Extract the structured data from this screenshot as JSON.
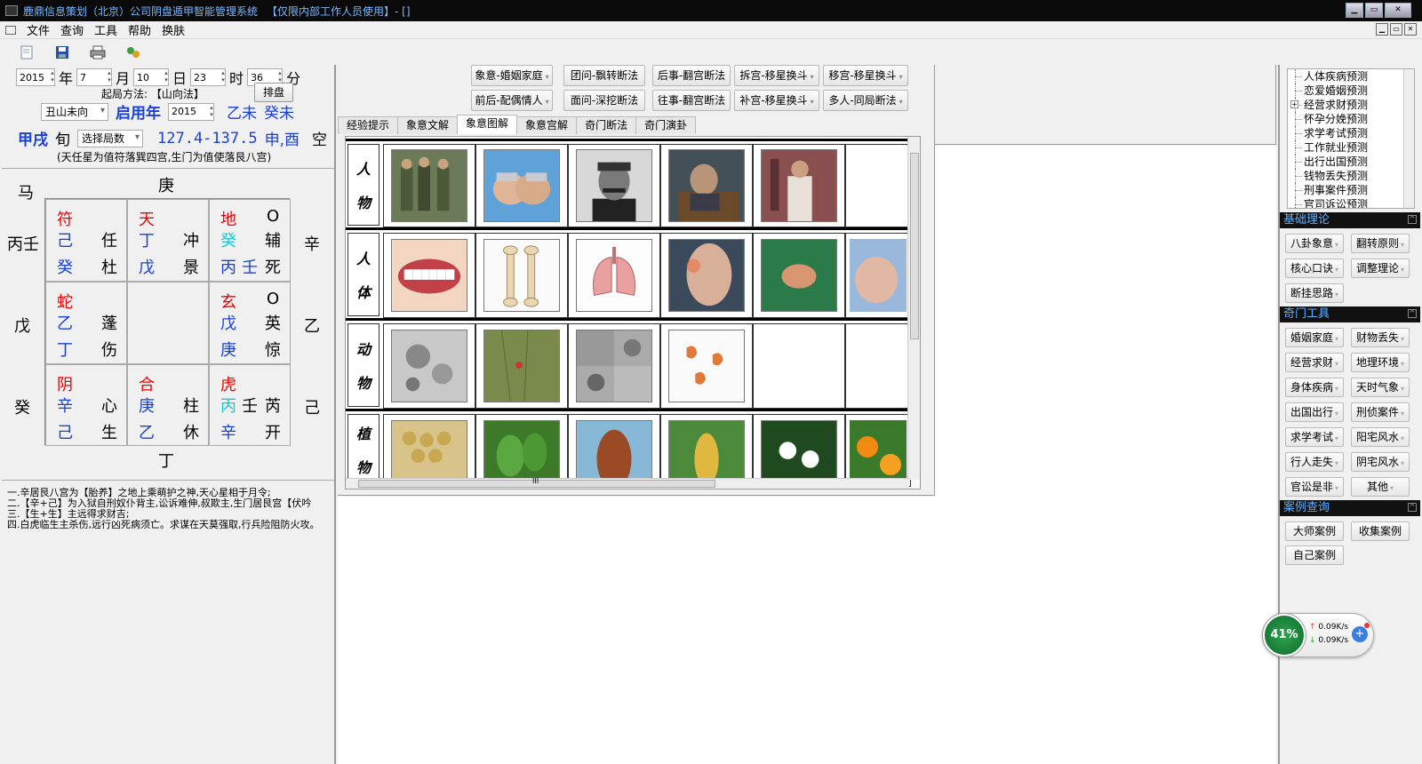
{
  "window": {
    "title": "鹿鼎信息策划（北京）公司阴盘遁甲智能管理系统",
    "title_tag": "【仅限内部工作人员使用】- []"
  },
  "menu": [
    "文件",
    "查询",
    "工具",
    "帮助",
    "换肤"
  ],
  "toolbar": [
    "new-icon",
    "save-icon",
    "print-icon",
    "plugin-icon"
  ],
  "datetime": {
    "year": "2015",
    "year_unit": "年",
    "month": "7",
    "month_unit": "月",
    "day": "10",
    "day_unit": "日",
    "hour": "23",
    "hour_unit": "时",
    "minute": "36",
    "minute_unit": "分"
  },
  "method": {
    "label": "起局方法: 【山向法】",
    "button": "排盘"
  },
  "row3": {
    "direction": "丑山未向",
    "use_year_label": "启用年",
    "use_year": "2015",
    "gz1": "乙未",
    "gz2": "癸未"
  },
  "row4": {
    "xun": "甲戌",
    "xun_unit": "旬",
    "ju_select": "选择局数",
    "degree": "127.4-137.5",
    "stem": "申,酉",
    "kong": "空"
  },
  "row5": {
    "note": "(天任星为值符落巽四宫,生门为值使落艮八宫)"
  },
  "pan": {
    "top_left": "马",
    "top": "庚",
    "bottom": "丁",
    "left": [
      "丙壬",
      "戊",
      "癸"
    ],
    "right": [
      "辛",
      "乙",
      "己"
    ],
    "cells": [
      {
        "god": "符",
        "sky_stem": "己",
        "star": "任",
        "earth_stem": "癸",
        "door": "杜"
      },
      {
        "god": "天",
        "sky_stem": "丁",
        "star": "冲",
        "earth_stem": "戊",
        "door": "景"
      },
      {
        "god": "地",
        "mark": "O",
        "sky_stem": "癸",
        "star": "辅",
        "earth_stem": "丙",
        "earth_stem2": "壬",
        "door": "死"
      },
      {
        "god": "蛇",
        "sky_stem": "乙",
        "star": "蓬",
        "earth_stem": "丁",
        "door": "伤"
      },
      {},
      {
        "god": "玄",
        "mark": "O",
        "sky_stem": "戊",
        "star": "英",
        "earth_stem": "庚",
        "door": "惊"
      },
      {
        "god": "阴",
        "sky_stem": "辛",
        "star": "心",
        "earth_stem": "己",
        "door": "生"
      },
      {
        "god": "合",
        "sky_stem": "庚",
        "star": "柱",
        "earth_stem": "乙",
        "door": "休"
      },
      {
        "god": "虎",
        "sky_stem": "丙",
        "sky_stem2": "壬",
        "star": "芮",
        "earth_stem": "辛",
        "door": "开"
      }
    ]
  },
  "notes": [
    "一.辛居艮八宫为【胎养】之地上乘萌护之神,天心星相于月令;",
    "二.【辛+己】为入狱自刑奴仆背主,讼诉难伸,叔欺主,生门居艮宫【伏吟",
    "三.【生+生】主远得求财吉;",
    "四.白虎临生主杀伤,远行凶死病须亡。求谋在天莫强取,行兵险阻防火攻。"
  ],
  "mid_buttons_row1": [
    "象意-婚姻家庭",
    "团问-飘转断法",
    "后事-翻宫断法",
    "拆宫-移星换斗",
    "移宫-移星换斗"
  ],
  "mid_buttons_row2": [
    "前后-配偶情人",
    "面问-深挖断法",
    "往事-翻宫断法",
    "补宫-移星换斗",
    "多人-同局断法"
  ],
  "tabs": [
    "经验提示",
    "象意文解",
    "象意图解",
    "象意宫解",
    "奇门断法",
    "奇门演卦"
  ],
  "active_tab": 2,
  "image_rows": [
    {
      "label": [
        "人",
        "物"
      ],
      "images": [
        "people-image",
        "handcuffs-image",
        "portrait-image",
        "official-image",
        "monk-image",
        ""
      ]
    },
    {
      "label": [
        "人",
        "体"
      ],
      "images": [
        "teeth-image",
        "bone-image",
        "lungs-image",
        "knee-image",
        "skin-image",
        "foot-image"
      ]
    },
    {
      "label": [
        "动",
        "物"
      ],
      "images": [
        "cells-image",
        "insect-image",
        "microscope-image",
        "embryo-image",
        "",
        ""
      ]
    },
    {
      "label": [
        "植",
        "物"
      ],
      "images": [
        "beans-image",
        "leaves-image",
        "sorghum-image",
        "corn-image",
        "jasmine-image",
        "marigold-image"
      ]
    }
  ],
  "hscroll_label": "III",
  "tree": [
    "人体疾病预测",
    "恋爱婚姻预测",
    "经营求财预测",
    "怀孕分娩预测",
    "求学考试预测",
    "工作就业预测",
    "出行出国预测",
    "钱物丢失预测",
    "刑事案件预测",
    "官司诉讼预测"
  ],
  "sections": {
    "basic": {
      "title": "基础理论",
      "buttons": [
        "八卦象意",
        "翻转原则",
        "核心口诀",
        "调整理论",
        "断挂思路"
      ]
    },
    "tools": {
      "title": "奇门工具",
      "buttons": [
        "婚姻家庭",
        "财物丢失",
        "经营求财",
        "地理环境",
        "身体疾病",
        "天时气象",
        "出国出行",
        "刑侦案件",
        "求学考试",
        "阳宅风水",
        "行人走失",
        "阴宅风水",
        "官讼是非",
        "其他"
      ]
    },
    "cases": {
      "title": "案例查询",
      "buttons": [
        "大师案例",
        "收集案例",
        "自己案例"
      ]
    }
  },
  "net": {
    "percent": "41%",
    "up": "0.09K/s",
    "down": "0.09K/s"
  }
}
